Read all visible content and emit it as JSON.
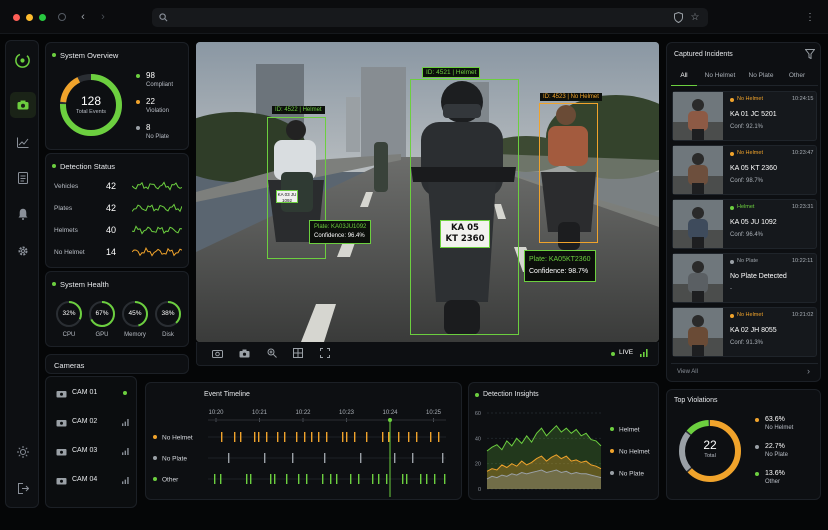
{
  "browser": {
    "window_buttons": [
      "close",
      "minimize",
      "maximize"
    ],
    "icons": [
      "back-icon",
      "forward-icon",
      "search-icon",
      "shield-icon",
      "star-icon",
      "more-icon"
    ]
  },
  "sidebar": {
    "icons": [
      "logo-icon",
      "camera-icon",
      "analytics-icon",
      "reports-icon",
      "alerts-icon",
      "settings-icon",
      "theme-icon",
      "logout-icon"
    ],
    "active": "camera-icon"
  },
  "overview": {
    "title": "System Overview",
    "total": "128",
    "total_label": "Total Events",
    "items": [
      {
        "value": "98",
        "label": "Compliant",
        "color": "#6ccf3f"
      },
      {
        "value": "22",
        "label": "Violation",
        "color": "#f0a32b"
      },
      {
        "value": "8",
        "label": "No Plate",
        "color": "#9aa0a6"
      }
    ]
  },
  "detection_status": {
    "title": "Detection Status",
    "rows": [
      {
        "label": "Vehicles",
        "value": "42",
        "color": "#6ccf3f"
      },
      {
        "label": "Plates",
        "value": "42",
        "color": "#6ccf3f"
      },
      {
        "label": "Helmets",
        "value": "40",
        "color": "#6ccf3f"
      },
      {
        "label": "No Helmet",
        "value": "14",
        "color": "#f0a32b"
      }
    ]
  },
  "system_health": {
    "title": "System Health",
    "gauges": [
      {
        "value": "32%",
        "label": "CPU",
        "fraction": 0.32
      },
      {
        "value": "67%",
        "label": "GPU",
        "fraction": 0.67
      },
      {
        "value": "45%",
        "label": "Memory",
        "fraction": 0.45
      },
      {
        "value": "38%",
        "label": "Disk",
        "fraction": 0.38
      }
    ]
  },
  "cameras": {
    "title": "Cameras",
    "items": [
      {
        "name": "CAM 01",
        "status_icon": "live-dot-icon"
      },
      {
        "name": "CAM 02",
        "status_icon": "signal-icon"
      },
      {
        "name": "CAM 03",
        "status_icon": "signal-icon"
      },
      {
        "name": "CAM 04",
        "status_icon": "signal-icon"
      }
    ]
  },
  "video": {
    "boxes": [
      {
        "id": "ID: 4522 | Helmet",
        "color": "#6ccf3f"
      },
      {
        "id": "ID: 4521 | Helmet",
        "color": "#6ccf3f"
      },
      {
        "id": "ID: 4523 | No Helmet",
        "color": "#f0a32b"
      }
    ],
    "plates": [
      {
        "plate_text": "KA 03 JU 1092",
        "plate": "Plate: KA03JU1092",
        "confidence": "Confidence: 96.4%"
      },
      {
        "plate_line1": "KA 05",
        "plate_line2": "KT 2360",
        "plate": "Plate: KA05KT2360",
        "confidence": "Confidence: 98.7%"
      }
    ],
    "toolbar_icons": [
      "snapshot-icon",
      "camera-icon",
      "zoom-icon",
      "grid-icon",
      "fullscreen-icon"
    ],
    "live": "LIVE"
  },
  "incidents": {
    "title": "Captured Incidents",
    "tabs": [
      "All",
      "No Helmet",
      "No Plate",
      "Other"
    ],
    "active_tab": "All",
    "items": [
      {
        "status": "No Helmet",
        "status_color": "#f0a32b",
        "time": "10:24:15",
        "plate": "KA 01 JC 5201",
        "conf": "Conf: 92.1%"
      },
      {
        "status": "No Helmet",
        "status_color": "#f0a32b",
        "time": "10:23:47",
        "plate": "KA 05 KT 2360",
        "conf": "Conf: 98.7%"
      },
      {
        "status": "Helmet",
        "status_color": "#6ccf3f",
        "time": "10:23:31",
        "plate": "KA 05 JU 1092",
        "conf": "Conf: 96.4%"
      },
      {
        "status": "No Plate",
        "status_color": "#9aa0a6",
        "time": "10:22:11",
        "plate": "No Plate Detected",
        "conf": "-"
      },
      {
        "status": "No Helmet",
        "status_color": "#f0a32b",
        "time": "10:21:02",
        "plate": "KA 02 JH 8055",
        "conf": "Conf: 91.3%"
      }
    ],
    "view_all": "View All"
  },
  "timeline": {
    "title": "Event Timeline",
    "times": [
      "10:20",
      "10:21",
      "10:22",
      "10:23",
      "10:24",
      "10:25"
    ],
    "rows": [
      {
        "label": "No Helmet",
        "color": "#f0a32b"
      },
      {
        "label": "No Plate",
        "color": "#9aa0a6"
      },
      {
        "label": "Other",
        "color": "#6ccf3f"
      }
    ]
  },
  "insights": {
    "title": "Detection Insights",
    "y_ticks": [
      "60",
      "40",
      "20",
      "0"
    ],
    "legend": [
      {
        "label": "Helmet",
        "color": "#6ccf3f"
      },
      {
        "label": "No Helmet",
        "color": "#f0a32b"
      },
      {
        "label": "No Plate",
        "color": "#9aa0a6"
      }
    ]
  },
  "chart_data": {
    "type": "area",
    "title": "Detection Insights",
    "ylim": [
      0,
      60
    ],
    "series": [
      {
        "name": "Helmet",
        "values": [
          30,
          33,
          35,
          31,
          38,
          34,
          40,
          36,
          42,
          37,
          44,
          48,
          42,
          46,
          50,
          45,
          48,
          44,
          47,
          42,
          44,
          39,
          38,
          34
        ]
      },
      {
        "name": "No Helmet",
        "values": [
          14,
          16,
          15,
          19,
          17,
          20,
          18,
          22,
          19,
          21,
          24,
          26,
          22,
          25,
          27,
          24,
          26,
          22,
          23,
          21,
          22,
          19,
          18,
          16
        ]
      },
      {
        "name": "No Plate",
        "values": [
          8,
          10,
          9,
          11,
          10,
          12,
          11,
          13,
          12,
          13,
          14,
          15,
          13,
          14,
          15,
          13,
          14,
          12,
          13,
          12,
          12,
          11,
          10,
          9
        ]
      }
    ]
  },
  "violations": {
    "title": "Top Violations",
    "total": "22",
    "total_label": "Total",
    "items": [
      {
        "value": "63.6%",
        "label": "No Helmet",
        "color": "#f0a32b",
        "fraction": 0.636
      },
      {
        "value": "22.7%",
        "label": "No Plate",
        "color": "#9aa0a6",
        "fraction": 0.227
      },
      {
        "value": "13.6%",
        "label": "Other",
        "color": "#6ccf3f",
        "fraction": 0.136
      }
    ]
  }
}
